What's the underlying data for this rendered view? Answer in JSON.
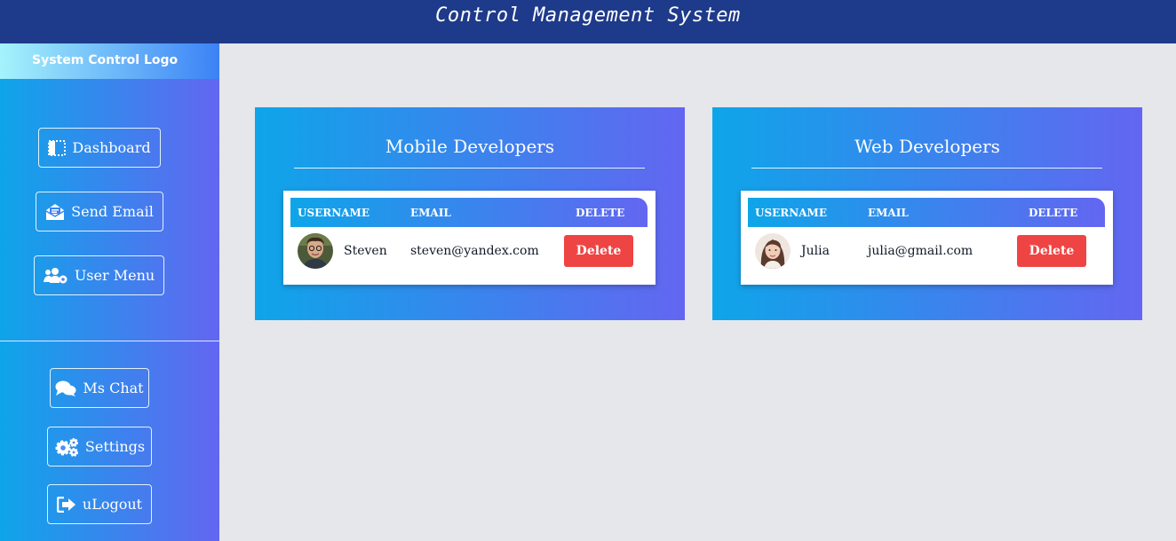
{
  "header": {
    "title": "Control Management System"
  },
  "sidebar": {
    "logo": "System Control Logo",
    "top_items": [
      {
        "label": "Dashboard",
        "icon": "dashboard-icon"
      },
      {
        "label": "Send Email",
        "icon": "envelope-open-icon"
      },
      {
        "label": "User Menu",
        "icon": "users-cog-icon"
      }
    ],
    "bottom_items": [
      {
        "label": "Ms Chat",
        "icon": "comments-icon"
      },
      {
        "label": "Settings",
        "icon": "cogs-icon"
      },
      {
        "label": "uLogout",
        "icon": "sign-out-icon"
      }
    ]
  },
  "cards": [
    {
      "title": "Mobile Developers",
      "columns": [
        "USERNAME",
        "EMAIL",
        "DELETE"
      ],
      "rows": [
        {
          "username": "Steven",
          "email": "steven@yandex.com",
          "action": "Delete"
        }
      ]
    },
    {
      "title": "Web Developers",
      "columns": [
        "USERNAME",
        "EMAIL",
        "DELETE"
      ],
      "rows": [
        {
          "username": "Julia",
          "email": "julia@gmail.com",
          "action": "Delete"
        }
      ]
    }
  ],
  "colors": {
    "header_bg": "#1e3a8a",
    "gradient_start": "#0ea5e9",
    "gradient_end": "#6366f1",
    "delete_button": "#ef4444",
    "content_bg": "#e5e7eb"
  }
}
